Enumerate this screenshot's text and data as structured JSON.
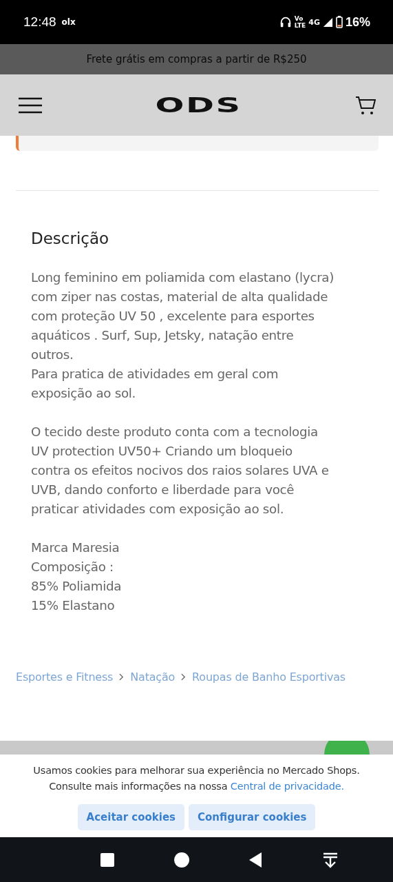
{
  "status_bar": {
    "time": "12:48",
    "notification": "olx",
    "network_top": "Vo",
    "network_bottom": "LTE",
    "network_type": "4G",
    "battery": "16%"
  },
  "promo_banner": {
    "text": "Frete grátis em compras a partir de R$250"
  },
  "header": {
    "logo": "ODS"
  },
  "description": {
    "title": "Descrição",
    "paragraphs": [
      "Long feminino em poliamida com elastano (lycra)\ncom ziper nas costas, material de alta qualidade\ncom proteção UV 50 , excelente para esportes\naquáticos . Surf, Sup, Jetsky, natação entre\noutros.\nPara pratica de atividades em geral com\nexposição ao sol.",
      "O tecido deste produto conta com a tecnologia\nUV protection UV50+ Criando um bloqueio\ncontra os efeitos nocivos dos raios solares UVA e\nUVB, dando conforto e liberdade para você\npraticar atividades com exposição ao sol.",
      "Marca Maresia\nComposição :\n85% Poliamida\n15% Elastano"
    ]
  },
  "breadcrumb": [
    "Esportes e Fitness",
    "Natação",
    "Roupas de Banho Esportivas"
  ],
  "cookie_banner": {
    "text": "Usamos cookies para melhorar sua experiência no Mercado Shops.",
    "text_2": "Consulte mais informações na nossa",
    "link": "Central de privacidade.",
    "buttons": [
      "Aceitar cookies",
      "Configurar cookies"
    ]
  }
}
